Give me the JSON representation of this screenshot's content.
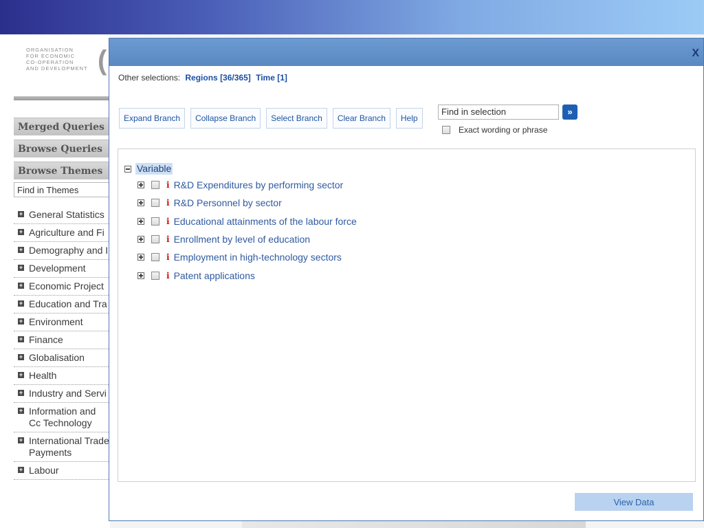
{
  "logo": {
    "lines": [
      "ORGANISATION",
      "FOR ECONOMIC",
      "CO-OPERATION",
      "AND DEVELOPMENT"
    ]
  },
  "sidebar": {
    "headings": [
      "Merged Queries",
      "Browse Queries",
      "Browse Themes"
    ],
    "find_themes": "Find in Themes",
    "themes": [
      "General Statistics",
      "Agriculture and Fi",
      "Demography and I",
      "Development",
      "Economic Project",
      "Education and Tra",
      "Environment",
      "Finance",
      "Globalisation",
      "Health",
      "Industry and Servi",
      "Information and Cc Technology",
      "International Trade Payments",
      "Labour"
    ]
  },
  "modal": {
    "close_label": "X",
    "other_selections": {
      "label": "Other selections:",
      "regions": "Regions [36/365]",
      "time": "Time [1]"
    },
    "toolbar": {
      "expand": "Expand Branch",
      "collapse": "Collapse Branch",
      "select": "Select Branch",
      "clear": "Clear Branch",
      "help": "Help"
    },
    "find": {
      "value": "Find in selection",
      "go_label": "»",
      "exact_label": "Exact wording or phrase"
    },
    "tree": {
      "root": "Variable",
      "items": [
        "R&D Expenditures by performing sector",
        "R&D Personnel by sector",
        "Educational attainments of the labour force",
        "Enrollment by level of education",
        "Employment in high-technology sectors",
        "Patent applications"
      ],
      "info_glyph": "i"
    },
    "view_data": "View Data"
  },
  "colors": {
    "accent": "#1e5fb4",
    "link": "#2f5aa0",
    "info": "#cc1111",
    "title_bar": "#6b9bd1"
  }
}
